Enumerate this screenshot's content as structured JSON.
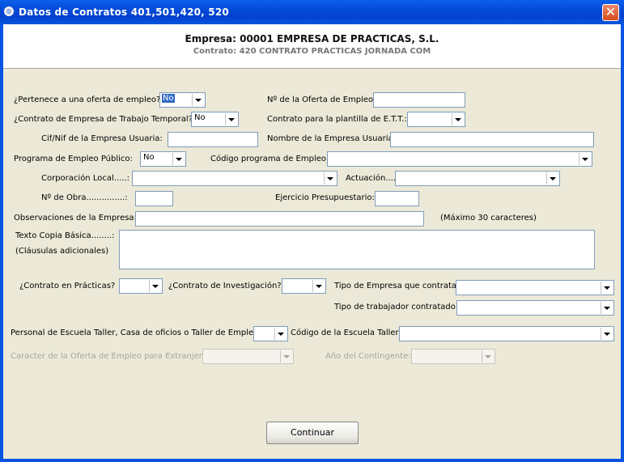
{
  "window": {
    "title": "Datos de Contratos 401,501,420, 520"
  },
  "header": {
    "company": "Empresa: 00001 EMPRESA DE PRACTICAS, S.L.",
    "contract": "Contrato: 420 CONTRATO PRACTICAS JORNADA COM"
  },
  "form": {
    "oferta_empleo_label": "¿Pertenece a una oferta de empleo?",
    "oferta_empleo_value": "No",
    "num_oferta_label": "Nº de la Oferta de Empleo:",
    "num_oferta_value": "",
    "ett_label": "¿Contrato de Empresa de Trabajo Temporal?",
    "ett_value": "No",
    "plantilla_ett_label": "Contrato para la plantilla de E.T.T.:",
    "plantilla_ett_value": "",
    "cif_label": "Cif/Nif de la Empresa Usuaria:",
    "cif_value": "",
    "nombre_empresa_label": "Nombre de la Empresa Usuaria:",
    "nombre_empresa_value": "",
    "programa_label": "Programa de Empleo Público:",
    "programa_value": "No",
    "codigo_programa_label": "Código programa de Empleo:",
    "codigo_programa_value": "",
    "corporacion_label": "Corporación Local.....:",
    "corporacion_value": "",
    "actuacion_label": "Actuación....",
    "actuacion_value": "",
    "obra_label": "Nº de Obra...............:",
    "obra_value": "",
    "ejercicio_label": "Ejercicio Presupuestario:",
    "ejercicio_value": "",
    "observaciones_label": "Observaciones de la Empresa:",
    "observaciones_value": "",
    "observaciones_hint": "(Máximo 30 caracteres)",
    "texto_copia_label": "Texto Copia Básica........:",
    "clausulas_label": "(Cláusulas adicionales)",
    "texto_copia_value": "",
    "practicas_label": "¿Contrato en Prácticas?",
    "practicas_value": "",
    "investigacion_label": "¿Contrato de Investigación?",
    "investigacion_value": "",
    "tipo_empresa_label": "Tipo de Empresa que contrata:",
    "tipo_empresa_value": "",
    "tipo_trabajador_label": "Tipo de trabajador contratado:",
    "tipo_trabajador_value": "",
    "escuela_label": "Personal de Escuela Taller, Casa de oficios o Taller de Empleo:",
    "escuela_value": "",
    "codigo_escuela_label": "Código de la Escuela Taller:",
    "codigo_escuela_value": "",
    "caracter_label": "Caracter de la Oferta de Empleo para Extranjeros:",
    "caracter_value": "",
    "contingente_label": "Año del Contingente:",
    "contingente_value": ""
  },
  "buttons": {
    "continuar": "Continuar"
  },
  "colors": {
    "titlebar": "#0a54e4",
    "client_bg": "#ece9d8",
    "selection": "#316ac5"
  }
}
